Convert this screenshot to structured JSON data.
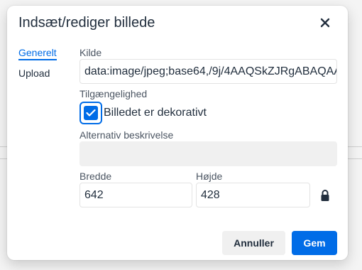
{
  "dialog": {
    "title": "Indsæt/rediger billede"
  },
  "tabs": [
    {
      "label": "Generelt",
      "active": true
    },
    {
      "label": "Upload",
      "active": false
    }
  ],
  "source": {
    "label": "Kilde",
    "value": "data:image/jpeg;base64,/9j/4AAQSkZJRgABAQAA"
  },
  "accessibility": {
    "label": "Tilgængelighed",
    "decorative_label": "Billedet er dekorativt",
    "decorative_checked": true
  },
  "alt_text": {
    "label": "Alternativ beskrivelse",
    "value": ""
  },
  "dimensions": {
    "width_label": "Bredde",
    "width_value": "642",
    "height_label": "Højde",
    "height_value": "428"
  },
  "buttons": {
    "cancel": "Annuller",
    "save": "Gem"
  },
  "colors": {
    "accent": "#006ce7",
    "text": "#222f3e"
  }
}
